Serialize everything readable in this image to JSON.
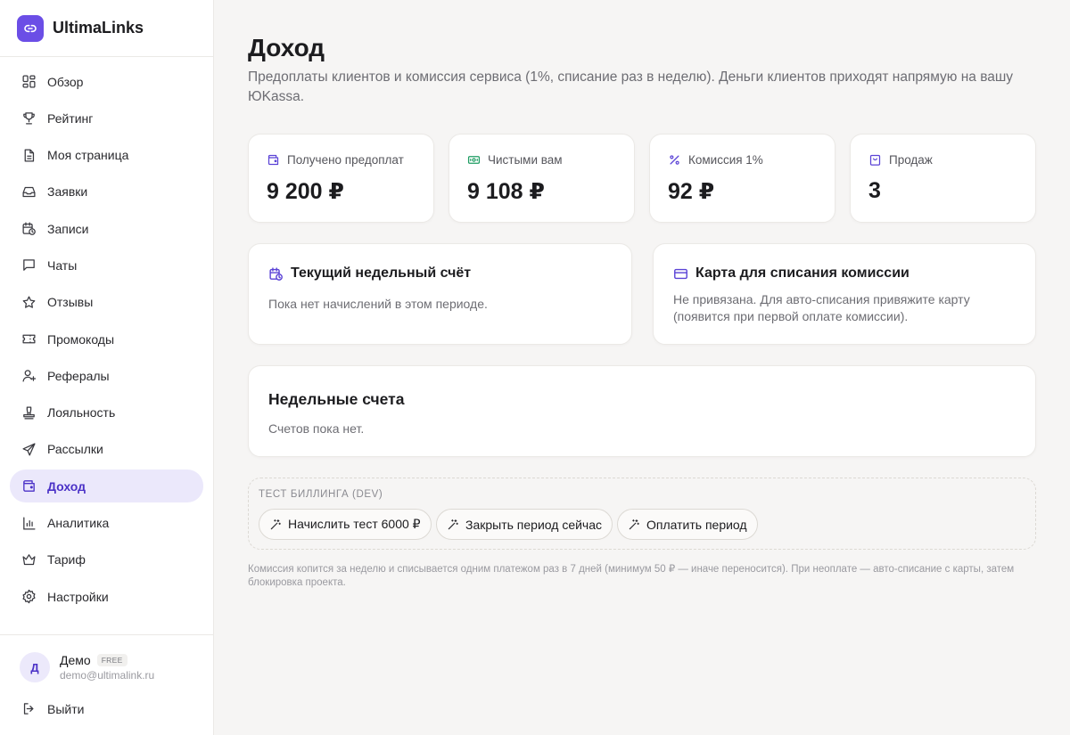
{
  "app": {
    "name": "UltimaLinks",
    "accent": "#6b4ee6"
  },
  "sidebar": {
    "items": [
      {
        "label": "Обзор",
        "icon": "grid-icon"
      },
      {
        "label": "Рейтинг",
        "icon": "trophy-icon"
      },
      {
        "label": "Моя страница",
        "icon": "document-icon"
      },
      {
        "label": "Заявки",
        "icon": "inbox-icon"
      },
      {
        "label": "Записи",
        "icon": "calendar-clock-icon"
      },
      {
        "label": "Чаты",
        "icon": "chat-icon"
      },
      {
        "label": "Отзывы",
        "icon": "star-icon"
      },
      {
        "label": "Промокоды",
        "icon": "ticket-icon"
      },
      {
        "label": "Рефералы",
        "icon": "user-plus-icon"
      },
      {
        "label": "Лояльность",
        "icon": "stamp-icon"
      },
      {
        "label": "Рассылки",
        "icon": "send-icon"
      },
      {
        "label": "Доход",
        "icon": "wallet-icon",
        "active": true
      },
      {
        "label": "Аналитика",
        "icon": "bar-chart-icon"
      },
      {
        "label": "Тариф",
        "icon": "crown-icon"
      },
      {
        "label": "Настройки",
        "icon": "gear-icon"
      }
    ],
    "user": {
      "initial": "Д",
      "name": "Демо",
      "plan": "FREE",
      "email": "demo@ultimalink.ru"
    },
    "logout_label": "Выйти"
  },
  "page": {
    "title": "Доход",
    "subtitle": "Предоплаты клиентов и комиссия сервиса (1%, списание раз в неделю). Деньги клиентов приходят напрямую на вашу ЮKassa."
  },
  "stats": [
    {
      "label": "Получено предоплат",
      "value": "9 200 ₽",
      "icon": "wallet-icon"
    },
    {
      "label": "Чистыми вам",
      "value": "9 108 ₽",
      "icon": "banknote-icon"
    },
    {
      "label": "Комиссия 1%",
      "value": "92 ₽",
      "icon": "percent-icon"
    },
    {
      "label": "Продаж",
      "value": "3",
      "icon": "shopping-bag-icon"
    }
  ],
  "current_bill": {
    "title": "Текущий недельный счёт",
    "text": "Пока нет начислений в этом периоде."
  },
  "card_info": {
    "title": "Карта для списания комиссии",
    "text_line1": "Не привязана. Для авто-списания привяжите карту",
    "text_line2": "(появится при первой оплате комиссии)."
  },
  "weekly_bills": {
    "title": "Недельные счета",
    "text": "Счетов пока нет."
  },
  "dev": {
    "label": "ТЕСТ БИЛЛИНГА (DEV)",
    "buttons": [
      "Начислить тест 6000 ₽",
      "Закрыть период сейчас",
      "Оплатить период"
    ]
  },
  "footnote": "Комиссия копится за неделю и списывается одним платежом раз в 7 дней (минимум 50 ₽ — иначе переносится). При неоплате — авто-списание с карты, затем блокировка проекта."
}
